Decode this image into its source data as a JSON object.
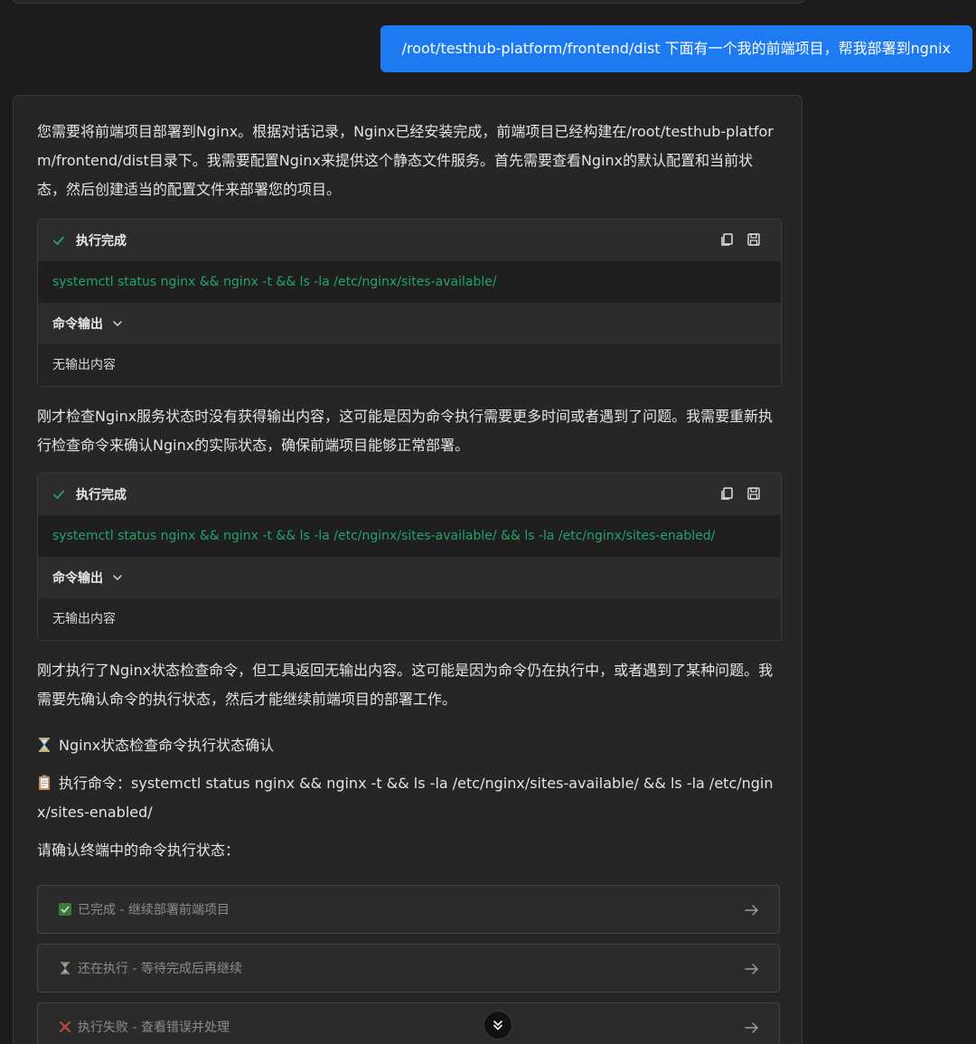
{
  "user_message": "/root/testhub-platform/frontend/dist 下面有一个我的前端项目，帮我部署到ngnix",
  "assistant": {
    "intro": "您需要将前端项目部署到Nginx。根据对话记录，Nginx已经安装完成，前端项目已经构建在/root/testhub-platform/frontend/dist目录下。我需要配置Nginx来提供这个静态文件服务。首先需要查看Nginx的默认配置和当前状态，然后创建适当的配置文件来部署您的项目。",
    "exec_blocks": [
      {
        "status": "执行完成",
        "command": "systemctl status nginx && nginx -t && ls -la /etc/nginx/sites-available/",
        "output_label": "命令输出",
        "output": "无输出内容"
      },
      {
        "status": "执行完成",
        "command": "systemctl status nginx && nginx -t && ls -la /etc/nginx/sites-available/ && ls -la /etc/nginx/sites-enabled/",
        "output_label": "命令输出",
        "output": "无输出内容"
      }
    ],
    "middle_para": "刚才检查Nginx服务状态时没有获得输出内容，这可能是因为命令执行需要更多时间或者遇到了问题。我需要重新执行检查命令来确认Nginx的实际状态，确保前端项目能够正常部署。",
    "after_para": "刚才执行了Nginx状态检查命令，但工具返回无输出内容。这可能是因为命令仍在执行中，或者遇到了某种问题。我需要先确认命令的执行状态，然后才能继续前端项目的部署工作。",
    "status_title": "Nginx状态检查命令执行状态确认",
    "exec_cmd_label": "执行命令：",
    "exec_cmd_value": "systemctl status nginx && nginx -t && ls -la /etc/nginx/sites-available/ && ls -la /etc/nginx/sites-enabled/",
    "confirm_prompt": "请确认终端中的命令执行状态：",
    "options": [
      {
        "label": "已完成 - 继续部署前端项目",
        "icon": "check-box-icon"
      },
      {
        "label": "还在执行 - 等待完成后再继续",
        "icon": "hourglass-icon"
      },
      {
        "label": "执行失败 - 查看错误并处理",
        "icon": "cross-icon"
      }
    ]
  },
  "colors": {
    "user_bubble": "#1e7af0",
    "command_green": "#23a36a",
    "background": "#1c1c1c",
    "card": "#262626"
  }
}
